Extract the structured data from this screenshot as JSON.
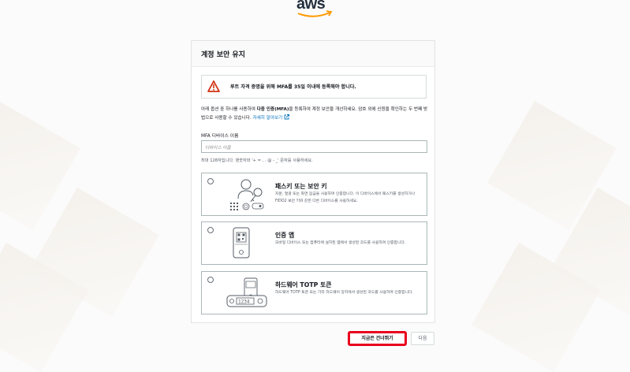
{
  "logo": {
    "text": "aws"
  },
  "card": {
    "title": "계정 보안 유지",
    "alert": "루트 자격 증명을 위해 MFA를 35일 이내에 등록해야 합니다.",
    "description": {
      "part1": "아래 옵션 중 하나를 사용하여 ",
      "emphasis": "다중 인증(MFA)",
      "part2": "을 등록하여 계정 보안을 개선하세요. 암호 외에 신원을 확인하는 두 번째 방법으로 사용할 수 있습니다.",
      "link": "자세히 알아보기"
    },
    "mfa_field": {
      "label": "MFA 디바이스 이름",
      "placeholder": "디바이스 이름",
      "hint": "최대 128자입니다. 영숫자와 '+ = , . @ - _' 문자를 사용하세요."
    },
    "options": [
      {
        "title": "패스키 또는 보안 키",
        "description": "지문, 얼굴 또는 화면 잠금을 사용하여 인증합니다. 이 디바이스에서 패스키를 생성하거나 FIDO2 보안 키와 같은 다른 디바이스를 사용하세요."
      },
      {
        "title": "인증 앱",
        "description": "모바일 디바이스 또는 컴퓨터에 설치된 앱에서 생성된 코드를 사용하여 인증합니다."
      },
      {
        "title": "하드웨어 TOTP 토큰",
        "description": "하드웨어 TOTP 토큰 또는 기타 하드웨어 장치에서 생성된 코드를 사용하여 인증합니다.",
        "token_digits": "1234"
      }
    ]
  },
  "buttons": {
    "skip": "지금은 건너뛰기",
    "next": "다음"
  },
  "colors": {
    "accent": "#ff9900",
    "link": "#0073bb",
    "alert": "#d13212",
    "highlight": "#e8001c"
  },
  "icons": [
    "warning-icon",
    "external-link-icon",
    "passkey-icon",
    "authenticator-app-icon",
    "hardware-token-icon"
  ]
}
